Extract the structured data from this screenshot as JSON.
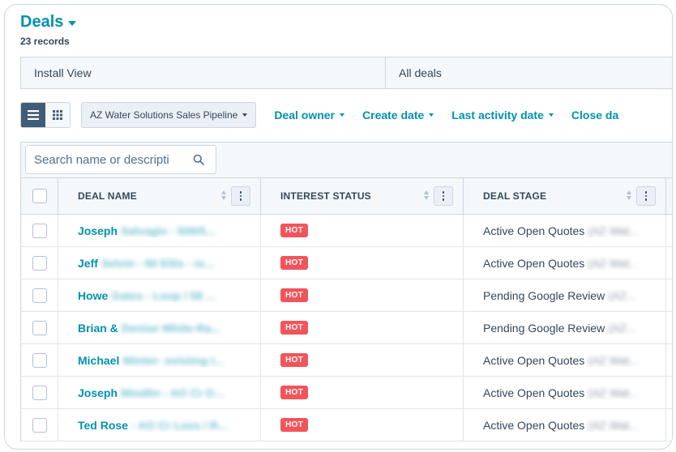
{
  "header": {
    "title": "Deals",
    "records": "23 records"
  },
  "views": [
    {
      "label": "Install View"
    },
    {
      "label": "All deals"
    }
  ],
  "toolbar": {
    "pipeline": "AZ Water Solutions Sales Pipeline",
    "filters": [
      {
        "label": "Deal owner"
      },
      {
        "label": "Create date"
      },
      {
        "label": "Last activity date"
      },
      {
        "label": "Close da"
      }
    ]
  },
  "search": {
    "placeholder": "Search name or descripti"
  },
  "table": {
    "columns": [
      {
        "label": "DEAL NAME"
      },
      {
        "label": "INTEREST STATUS"
      },
      {
        "label": "DEAL STAGE"
      }
    ],
    "rows": [
      {
        "name": "Joseph",
        "name_blur": "Salvagio - 506/5...",
        "status": "HOT",
        "stage": "Active Open Quotes",
        "stage_blur": "(AZ Wat..."
      },
      {
        "name": "Jeff",
        "name_blur": "Selvin - 60 Ellis - re...",
        "status": "HOT",
        "stage": "Active Open Quotes",
        "stage_blur": "(AZ Wat..."
      },
      {
        "name": "Howe",
        "name_blur": "Gates - Loop / 58 ...",
        "status": "HOT",
        "stage": "Pending Google Review",
        "stage_blur": "(AZ..."
      },
      {
        "name": "Brian &",
        "name_blur": "Denise White-Ra...",
        "status": "HOT",
        "stage": "Pending Google Review",
        "stage_blur": "(AZ..."
      },
      {
        "name": "Michael",
        "name_blur": "Winter- existing l...",
        "status": "HOT",
        "stage": "Active Open Quotes",
        "stage_blur": "(AZ Wat..."
      },
      {
        "name": "Joseph",
        "name_blur": "Mindlin - AO Cr D...",
        "status": "HOT",
        "stage": "Active Open Quotes",
        "stage_blur": "(AZ Wat..."
      },
      {
        "name": "Ted Rose",
        "name_blur": "- AO Cr Loss / R...",
        "status": "HOT",
        "stage": "Active Open Quotes",
        "stage_blur": "(AZ Wat..."
      }
    ]
  },
  "colors": {
    "brand": "#0091ae",
    "hot": "#f2545b",
    "text": "#33475b"
  }
}
